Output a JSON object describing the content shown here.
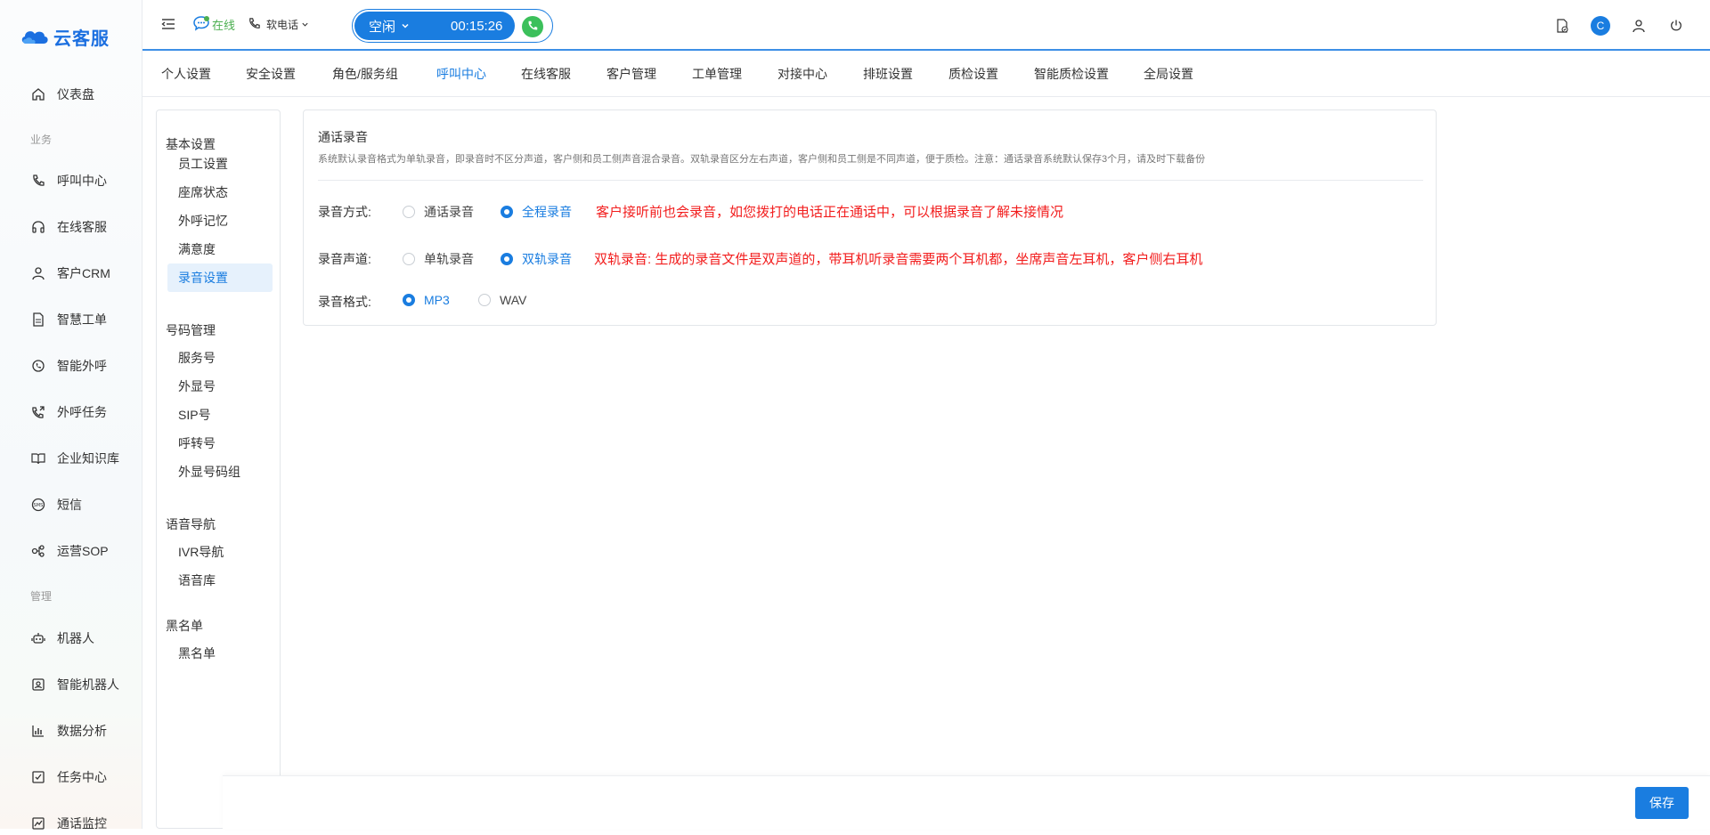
{
  "app": {
    "name": "云客服"
  },
  "sidebar": {
    "items": [
      {
        "label": "仪表盘",
        "icon": "home-icon"
      },
      {
        "label": "呼叫中心",
        "icon": "phone-icon"
      },
      {
        "label": "在线客服",
        "icon": "headset-icon"
      },
      {
        "label": "客户CRM",
        "icon": "user-icon"
      },
      {
        "label": "智慧工单",
        "icon": "document-icon"
      },
      {
        "label": "智能外呼",
        "icon": "whatsapp-icon"
      },
      {
        "label": "外呼任务",
        "icon": "phone-forward-icon"
      },
      {
        "label": "企业知识库",
        "icon": "book-icon"
      },
      {
        "label": "短信",
        "icon": "sms-icon"
      },
      {
        "label": "运营SOP",
        "icon": "flow-icon"
      },
      {
        "label": "机器人",
        "icon": "robot-icon"
      },
      {
        "label": "智能机器人",
        "icon": "smart-robot-icon"
      },
      {
        "label": "数据分析",
        "icon": "bar-chart-icon"
      },
      {
        "label": "任务中心",
        "icon": "checkbox-icon"
      },
      {
        "label": "通话监控",
        "icon": "monitor-chart-icon"
      }
    ],
    "groups": {
      "business": "业务",
      "manage": "管理"
    }
  },
  "topbar": {
    "status": "在线",
    "phone_type": "软电话",
    "call_state": "空闲",
    "timer": "00:15:26",
    "avatar_letter": "C"
  },
  "tabs": [
    {
      "label": "个人设置"
    },
    {
      "label": "安全设置"
    },
    {
      "label": "角色/服务组"
    },
    {
      "label": "呼叫中心",
      "active": true
    },
    {
      "label": "在线客服"
    },
    {
      "label": "客户管理"
    },
    {
      "label": "工单管理"
    },
    {
      "label": "对接中心"
    },
    {
      "label": "排班设置"
    },
    {
      "label": "质检设置"
    },
    {
      "label": "智能质检设置"
    },
    {
      "label": "全局设置"
    }
  ],
  "settings_menu": {
    "groups": [
      {
        "title": "基本设置",
        "items": [
          "员工设置",
          "座席状态",
          "外呼记忆",
          "满意度",
          "录音设置"
        ]
      },
      {
        "title": "号码管理",
        "items": [
          "服务号",
          "外显号",
          "SIP号",
          "呼转号",
          "外显号码组"
        ]
      },
      {
        "title": "语音导航",
        "items": [
          "IVR导航",
          "语音库"
        ]
      },
      {
        "title": "黑名单",
        "items": [
          "黑名单"
        ]
      }
    ],
    "active": "录音设置"
  },
  "panel": {
    "title": "通话录音",
    "description": "系统默认录音格式为单轨录音，即录音时不区分声道，客户侧和员工侧声音混合录音。双轨录音区分左右声道，客户侧和员工侧是不同声道，便于质检。注意：通话录音系统默认保存3个月，请及时下载备份",
    "rows": [
      {
        "label": "录音方式:",
        "options": [
          "通话录音",
          "全程录音"
        ],
        "selected": 1,
        "note": "客户接听前也会录音，如您拨打的电话正在通话中，可以根据录音了解未接情况"
      },
      {
        "label": "录音声道:",
        "options": [
          "单轨录音",
          "双轨录音"
        ],
        "selected": 1,
        "note": "双轨录音: 生成的录音文件是双声道的，带耳机听录音需要两个耳机都，坐席声音左耳机，客户侧右耳机"
      },
      {
        "label": "录音格式:",
        "options": [
          "MP3",
          "WAV"
        ],
        "selected": 0,
        "note": ""
      }
    ]
  },
  "footer": {
    "save_label": "保存"
  },
  "colors": {
    "accent": "#1a7de0",
    "note_red": "#f21d1d",
    "online_green": "#4caf50",
    "call_green": "#3cc05b"
  }
}
